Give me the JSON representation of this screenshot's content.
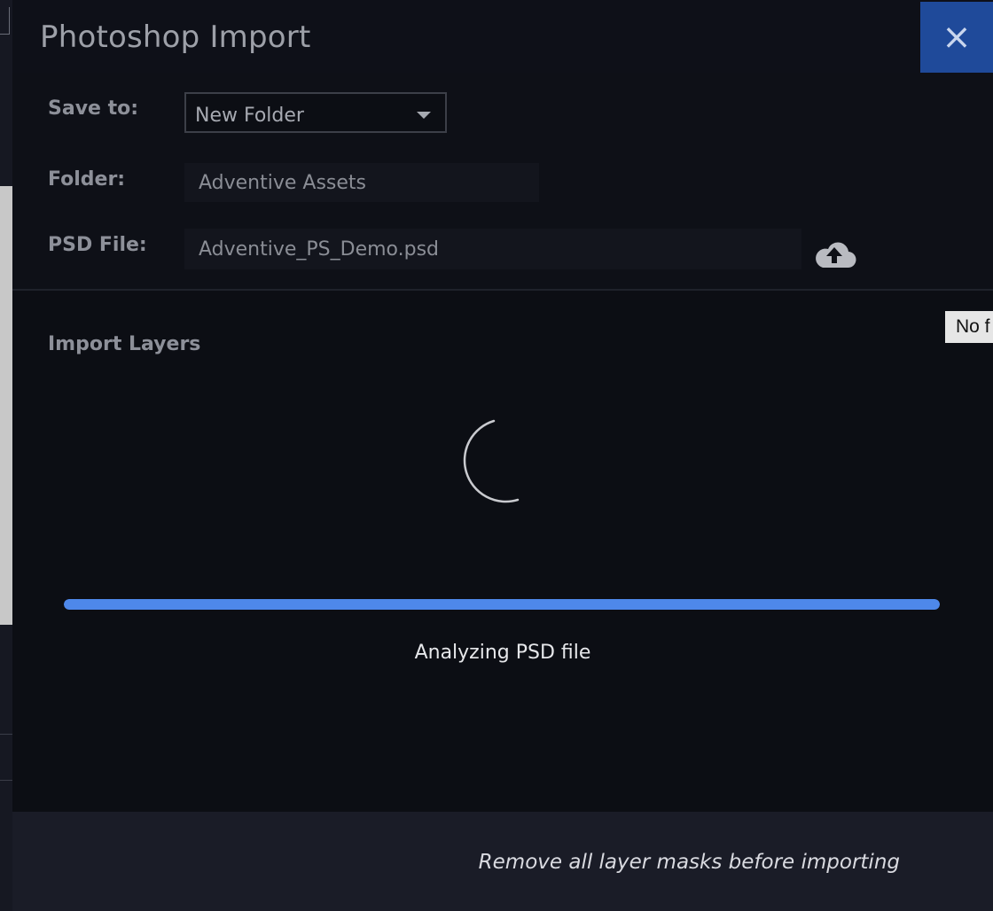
{
  "dialog": {
    "title": "Photoshop Import",
    "close_label": "×"
  },
  "form": {
    "save_to": {
      "label": "Save to:",
      "value": "New Folder"
    },
    "folder": {
      "label": "Folder:",
      "value": "Adventive Assets"
    },
    "psd_file": {
      "label": "PSD File:",
      "value": "Adventive_PS_Demo.psd",
      "icon": "cloud-upload-icon"
    }
  },
  "import_layers": {
    "title": "Import Layers",
    "progress": 1.0,
    "status": "Analyzing PSD file"
  },
  "footer": {
    "note": "Remove all layer masks before importing"
  },
  "side_tooltip": "No f",
  "colors": {
    "accent": "#4e88ea",
    "close_bg": "#1f4a9a",
    "panel_bg": "#0c0e14",
    "footer_bg": "#1a1c27"
  }
}
